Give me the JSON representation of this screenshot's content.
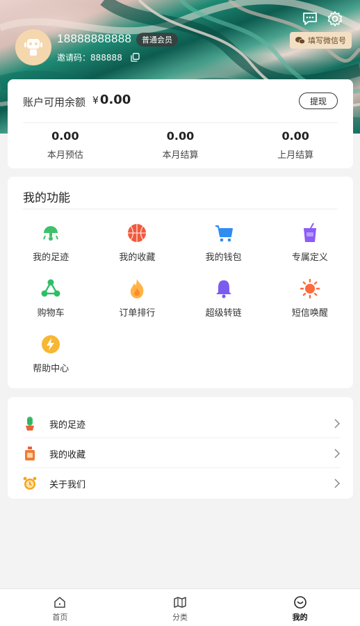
{
  "header": {
    "phone": "18888888888",
    "level": "普通会员",
    "invite_label": "邀请码：",
    "invite_code": "888888",
    "wechat_button": "填写微信号",
    "icons": [
      "message-icon",
      "settings-icon"
    ]
  },
  "balance": {
    "label": "账户可用余额",
    "currency": "¥",
    "amount": "0.00",
    "withdraw_label": "提现",
    "stats": [
      {
        "value": "0.00",
        "label": "本月预估"
      },
      {
        "value": "0.00",
        "label": "本月结算"
      },
      {
        "value": "0.00",
        "label": "上月结算"
      }
    ]
  },
  "functions": {
    "title": "我的功能",
    "items": [
      {
        "label": "我的足迹",
        "icon": "footprint-icon",
        "color": "#3ec16b"
      },
      {
        "label": "我的收藏",
        "icon": "basketball-icon",
        "color": "#f05a3c"
      },
      {
        "label": "我的钱包",
        "icon": "cart-icon",
        "color": "#2f8cf0"
      },
      {
        "label": "专属定义",
        "icon": "drink-cup-icon",
        "color": "#8b5cf6"
      },
      {
        "label": "购物车",
        "icon": "share-icon",
        "color": "#2fbe68"
      },
      {
        "label": "订单排行",
        "icon": "fire-icon",
        "color": "#ffa03a"
      },
      {
        "label": "超级转链",
        "icon": "bell-icon",
        "color": "#7b5cf0"
      },
      {
        "label": "短信唤醒",
        "icon": "sun-icon",
        "color": "#ff6a3d"
      },
      {
        "label": "帮助中心",
        "icon": "lightning-icon",
        "color": "#f7b733"
      }
    ]
  },
  "list": {
    "items": [
      {
        "label": "我的足迹",
        "icon": "cactus-icon"
      },
      {
        "label": "我的收藏",
        "icon": "perfume-icon"
      },
      {
        "label": "关于我们",
        "icon": "alarm-clock-icon"
      }
    ]
  },
  "tabbar": {
    "items": [
      {
        "label": "首页",
        "icon": "home-icon",
        "active": false
      },
      {
        "label": "分类",
        "icon": "map-icon",
        "active": false
      },
      {
        "label": "我的",
        "icon": "profile-icon",
        "active": true
      }
    ]
  }
}
